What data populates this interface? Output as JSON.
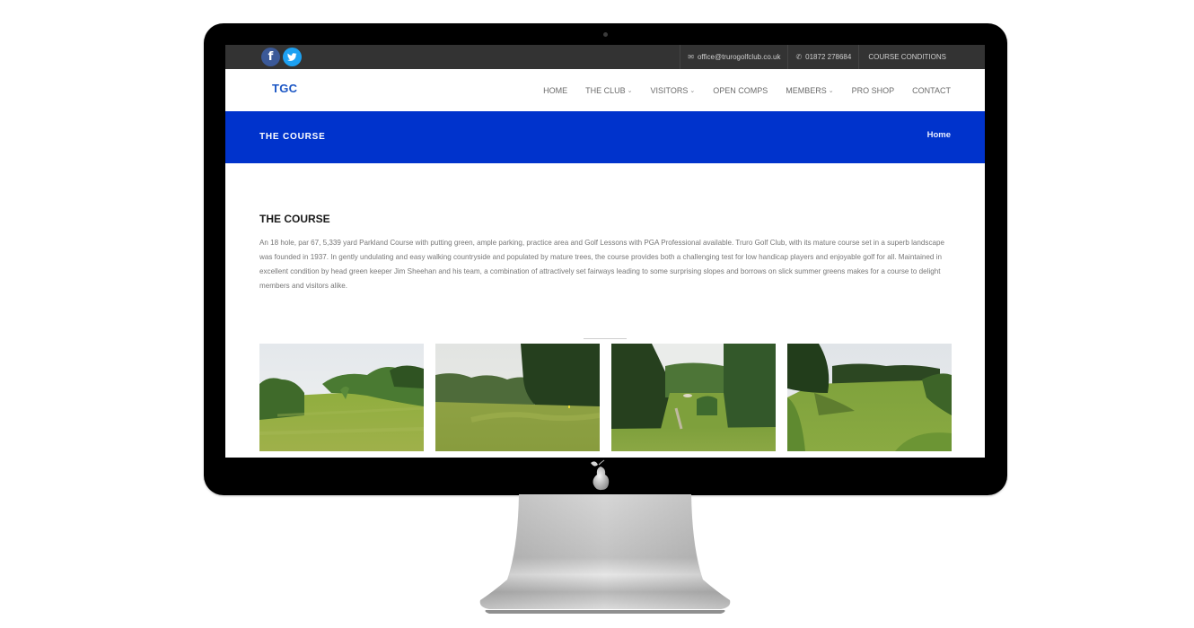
{
  "topbar": {
    "social": [
      {
        "name": "facebook",
        "glyph": "f"
      },
      {
        "name": "twitter",
        "glyph": "🐦"
      }
    ],
    "email": "office@trurogolfclub.co.uk",
    "phone": "01872 278684",
    "conditions_label": "COURSE CONDITIONS",
    "email_icon": "✉",
    "phone_icon": "✆"
  },
  "header": {
    "logo": "TGC",
    "nav": [
      {
        "label": "HOME",
        "dropdown": false
      },
      {
        "label": "THE CLUB",
        "dropdown": true
      },
      {
        "label": "VISITORS",
        "dropdown": true
      },
      {
        "label": "OPEN COMPS",
        "dropdown": false
      },
      {
        "label": "MEMBERS",
        "dropdown": true
      },
      {
        "label": "PRO SHOP",
        "dropdown": false
      },
      {
        "label": "CONTACT",
        "dropdown": false
      }
    ],
    "chevron": "⌄"
  },
  "banner": {
    "title": "THE COURSE",
    "breadcrumb": "Home"
  },
  "content": {
    "heading": "THE COURSE",
    "body": "An 18 hole, par 67, 5,339 yard Parkland Course with putting green, ample parking, practice area and Golf Lessons with PGA Professional available. Truro Golf Club, with its mature course set in a superb landscape was founded in 1937. In gently undulating and easy walking countryside and populated by mature trees, the course provides both a challenging test for low handicap players and enjoyable golf for all. Maintained in excellent condition by head green keeper Jim Sheehan and his team, a combination of attractively set fairways leading to some surprising slopes and borrows on slick summer greens makes for a course to delight members and visitors alike."
  },
  "gallery": [
    {
      "alt": "Striped fairway lined with trees"
    },
    {
      "alt": "Fairway approach to green with flag"
    },
    {
      "alt": "Tee view down tree-lined hole"
    },
    {
      "alt": "Wide fairway with shaded trees"
    }
  ],
  "colors": {
    "brand_blue": "#0033cc",
    "logo_blue": "#1a55c4",
    "topbar": "#333333"
  }
}
